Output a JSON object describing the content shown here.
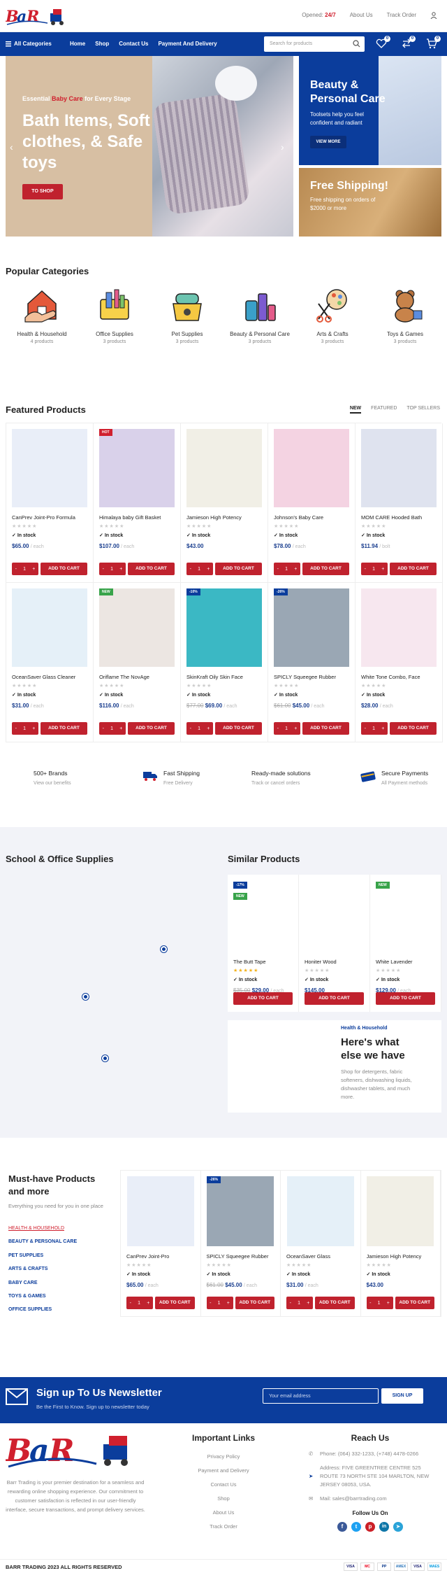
{
  "brand": {
    "colors": {
      "primary": "#0b3d9c",
      "accent": "#c0222e"
    }
  },
  "topbar": {
    "opened_prefix": "Opened:",
    "opened_value": "24/7",
    "about": "About Us",
    "track": "Track Order"
  },
  "navbar": {
    "all_categories": "All Categories",
    "links": [
      "Home",
      "Shop",
      "Contact Us",
      "Payment And Delivery"
    ],
    "search_placeholder": "Search for products",
    "wishlist_count": "0",
    "compare_count": "0",
    "cart_count": "0"
  },
  "hero": {
    "tagline_pre": "Essential",
    "tagline_hl": "Baby Care",
    "tagline_post": "for Every Stage",
    "title": "Bath Items, Soft clothes, & Safe toys",
    "button": "TO SHOP"
  },
  "promo1": {
    "title": "Beauty & Personal Care",
    "text": "Toolsets help you feel confident and radiant",
    "button": "VIEW MORE"
  },
  "promo2": {
    "title": "Free Shipping!",
    "text": "Free shipping on orders of $2000 or more"
  },
  "categories": {
    "title": "Popular Categories",
    "items": [
      {
        "name": "Health & Household",
        "count": "4 products",
        "icon": "health-household-icon"
      },
      {
        "name": "Office Supplies",
        "count": "3 products",
        "icon": "office-supplies-icon"
      },
      {
        "name": "Pet Supplies",
        "count": "3 products",
        "icon": "pet-supplies-icon"
      },
      {
        "name": "Beauty & Personal Care",
        "count": "3 products",
        "icon": "beauty-care-icon"
      },
      {
        "name": "Arts & Crafts",
        "count": "3 products",
        "icon": "arts-crafts-icon"
      },
      {
        "name": "Toys & Games",
        "count": "3 products",
        "icon": "toys-games-icon"
      }
    ]
  },
  "featured": {
    "title": "Featured Products",
    "tabs": [
      "NEW",
      "FEATURED",
      "TOP SELLERS"
    ],
    "in_stock": "In stock",
    "add_to_cart": "ADD TO CART",
    "qty": "1",
    "products": [
      {
        "name": "CanPrev Joint-Pro Formula",
        "price": "$65.00",
        "old": "",
        "unit": "/ each",
        "label": "",
        "color": "#e9eef8"
      },
      {
        "name": "Himalaya baby Gift Basket",
        "price": "$107.00",
        "old": "",
        "unit": "/ each",
        "label": "HOT",
        "color": "#d9d1ea"
      },
      {
        "name": "Jamieson High Potency",
        "price": "$43.00",
        "old": "",
        "unit": "",
        "label": "",
        "color": "#f1efe6"
      },
      {
        "name": "Johnson's Baby Care",
        "price": "$78.00",
        "old": "",
        "unit": "/ each",
        "label": "",
        "color": "#f4d3e2"
      },
      {
        "name": "MOM CARE Hooded Bath",
        "price": "$11.94",
        "old": "",
        "unit": "/ bolt",
        "label": "",
        "color": "#dfe3ef"
      },
      {
        "name": "OceanSaver Glass Cleaner",
        "price": "$31.00",
        "old": "",
        "unit": "/ each",
        "label": "",
        "color": "#e5f0f8"
      },
      {
        "name": "Oriflame The NovAge",
        "price": "$116.00",
        "old": "",
        "unit": "/ each",
        "label": "NEW",
        "color": "#ece6e2"
      },
      {
        "name": "SkinKraft Oily Skin Face",
        "price": "$69.00",
        "old": "$77.00",
        "unit": "/ each",
        "label": "-10%",
        "color": "#3bb8c4"
      },
      {
        "name": "SPICLY Squeegee Rubber",
        "price": "$45.00",
        "old": "$61.00",
        "unit": "/ each",
        "label": "-26%",
        "color": "#9aa7b4"
      },
      {
        "name": "White Tone Combo, Face",
        "price": "$28.00",
        "old": "",
        "unit": "/ each",
        "label": "",
        "color": "#f7e7ef"
      }
    ]
  },
  "features": [
    {
      "title": "500+ Brands",
      "sub": "View our benefits",
      "icon": "tag-icon"
    },
    {
      "title": "Fast Shipping",
      "sub": "Free Delivery",
      "icon": "truck-icon"
    },
    {
      "title": "Ready-made solutions",
      "sub": "Track or cancel orders",
      "icon": "box-icon"
    },
    {
      "title": "Secure Payments",
      "sub": "All Payment methods",
      "icon": "card-icon"
    }
  ],
  "school": {
    "title": "School & Office Supplies"
  },
  "similar": {
    "title": "Similar Products",
    "products": [
      {
        "name": "The Butt Tape",
        "price": "$29.00",
        "old": "$35.00",
        "unit": "/ each",
        "label": "-17%",
        "label2": "NEW",
        "rating": "5"
      },
      {
        "name": "Honiter Wood",
        "price": "$145.00",
        "old": "",
        "unit": "",
        "label": "",
        "label2": "",
        "rating": "0"
      },
      {
        "name": "White Lavender",
        "price": "$129.00",
        "old": "",
        "unit": "/ each",
        "label": "NEW",
        "label2": "",
        "rating": "0"
      }
    ]
  },
  "here": {
    "kicker": "Health & Household",
    "title": "Here's what else we have",
    "text": "Shop for detergents, fabric softeners, dishwashing liquids, dishwasher tablets, and much more."
  },
  "must": {
    "title": "Must-have Products and more",
    "sub": "Everything you need for you in one place",
    "links": [
      "HEALTH & HOUSEHOLD",
      "BEAUTY & PERSONAL CARE",
      "PET SUPPLIES",
      "ARTS & CRAFTS",
      "BABY CARE",
      "TOYS & GAMES",
      "OFFICE SUPPLIES"
    ],
    "products": [
      {
        "name": "CanPrev Joint-Pro",
        "price": "$65.00",
        "old": "",
        "unit": "/ each",
        "label": "",
        "color": "#e9eef8"
      },
      {
        "name": "SPICLY Squeegee Rubber",
        "price": "$45.00",
        "old": "$61.00",
        "unit": "/ each",
        "label": "-26%",
        "color": "#9aa7b4"
      },
      {
        "name": "OceanSaver Glass",
        "price": "$31.00",
        "old": "",
        "unit": "/ each",
        "label": "",
        "color": "#e5f0f8"
      },
      {
        "name": "Jamieson High Potency",
        "price": "$43.00",
        "old": "",
        "unit": "",
        "label": "",
        "color": "#f1efe6"
      }
    ]
  },
  "newsletter": {
    "title": "Sign up To Us Newsletter",
    "sub": "Be the First to Know. Sign up to newsletter today",
    "placeholder": "Your email address",
    "button": "SIGN UP"
  },
  "footer": {
    "about": "Barr Trading is your premier destination for a seamless and rewarding online shopping experience. Our commitment to customer satisfaction is reflected in our user-friendly interface, secure transactions, and prompt delivery services.",
    "links_title": "Important Links",
    "links": [
      "Privacy Policy",
      "Payment and Delivery",
      "Contact Us",
      "Shop",
      "About Us",
      "Track Order"
    ],
    "reach_title": "Reach Us",
    "phone": "Phone: (064) 332-1233, (+748) 4478-0266",
    "address": "Address: FIVE GREENTREE CENTRE 525 ROUTE 73 NORTH STE 104 MARLTON, NEW JERSEY 08053, USA.",
    "mail": "Mail: sales@barrtrading.com",
    "follow": "Follow Us On",
    "copyright": "BARR TRADING 2023 ALL RIGHTS RESERVED",
    "payments": [
      "VISA",
      "MC",
      "PP",
      "AMEX",
      "VISA",
      "MAES"
    ]
  }
}
